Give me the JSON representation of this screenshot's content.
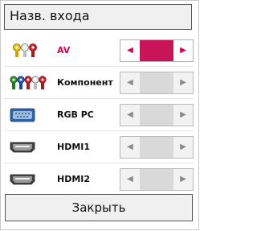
{
  "dialog": {
    "title": "Назв. входа",
    "close_label": "Закрыть"
  },
  "inputs": [
    {
      "label": "AV",
      "icon": "av-rca-icon",
      "selected": true
    },
    {
      "label": "Компонент",
      "icon": "component-rca-icon",
      "selected": false
    },
    {
      "label": "RGB PC",
      "icon": "rgb-pc-port-icon",
      "selected": false
    },
    {
      "label": "HDMI1",
      "icon": "hdmi-port-icon",
      "selected": false
    },
    {
      "label": "HDMI2",
      "icon": "hdmi-port-icon",
      "selected": false
    }
  ],
  "selector": {
    "left_arrow": "◀",
    "right_arrow": "▶"
  },
  "colors": {
    "accent": "#e0004d",
    "highlight_fill": "#c8155a"
  }
}
